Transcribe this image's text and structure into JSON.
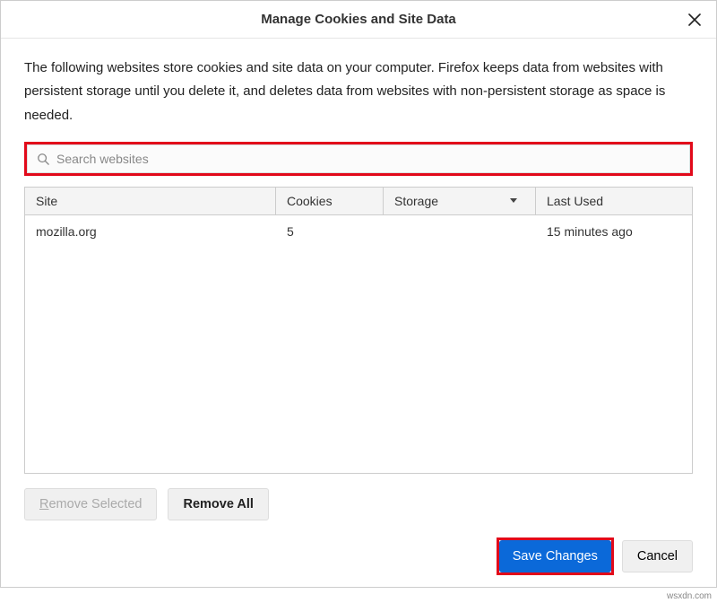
{
  "header": {
    "title": "Manage Cookies and Site Data"
  },
  "desc": "The following websites store cookies and site data on your computer. Firefox keeps data from websites with persistent storage until you delete it, and deletes data from websites with non-persistent storage as space is needed.",
  "search": {
    "placeholder": "Search websites",
    "value": ""
  },
  "columns": {
    "site": "Site",
    "cookies": "Cookies",
    "storage": "Storage",
    "last_used": "Last Used"
  },
  "rows": [
    {
      "site": "mozilla.org",
      "cookies": "5",
      "storage": "",
      "last_used": "15 minutes ago"
    }
  ],
  "buttons": {
    "remove_selected_prefix": "R",
    "remove_selected_rest": "emove Selected",
    "remove_all_prefix": "R",
    "remove_all_rest": "emove All",
    "save": "Save Changes",
    "cancel": "Cancel"
  },
  "watermark": "wsxdn.com"
}
